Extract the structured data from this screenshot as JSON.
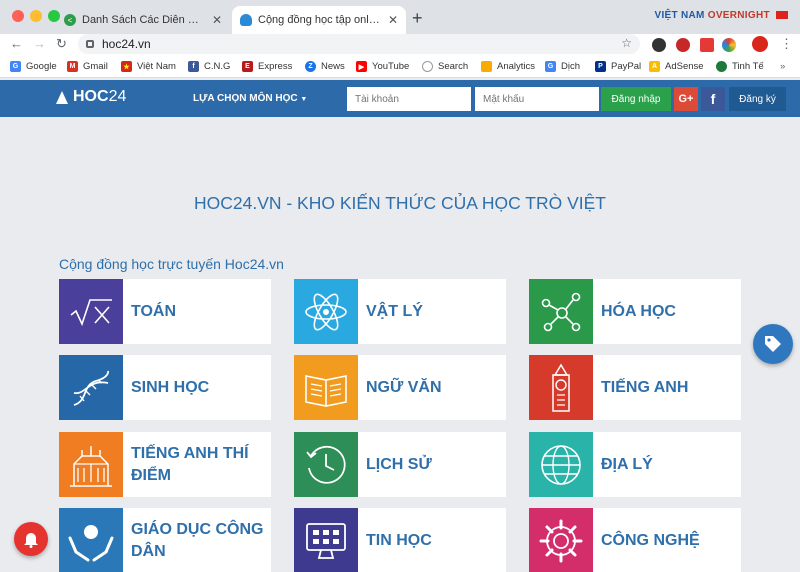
{
  "browser": {
    "tabs": [
      {
        "title": "Danh Sách Các Diễn Đàn Học T"
      },
      {
        "title": "Cộng đồng học tập online | Họ"
      }
    ],
    "brand_left": "VIỆT NAM",
    "brand_right": "OVERNIGHT",
    "url": "hoc24.vn",
    "bookmarks": [
      "Google",
      "Gmail",
      "Việt Nam",
      "C.N.G",
      "Express",
      "News",
      "YouTube",
      "Search",
      "Analytics",
      "Dịch",
      "PayPal",
      "AdSense",
      "Tinh Tế"
    ]
  },
  "header": {
    "logo_bold": "HOC",
    "logo_num": "24",
    "subjects_menu": "LỰA CHỌN MÔN HỌC",
    "username_placeholder": "Tài khoản",
    "password_placeholder": "Mật khẩu",
    "login_label": "Đăng nhập",
    "google_label": "G+",
    "facebook_label": "f",
    "register_label": "Đăng ký"
  },
  "main": {
    "headline": "HOC24.VN - KHO KIẾN THỨC CỦA HỌC TRÒ VIỆT",
    "community_title": "Cộng đồng học trực tuyến Hoc24.vn",
    "subjects": [
      {
        "label": "TOÁN",
        "icon": "math-sqrt-icon",
        "color": "#4a3f9a"
      },
      {
        "label": "VẬT LÝ",
        "icon": "atom-icon",
        "color": "#2aa9e0"
      },
      {
        "label": "HÓA HỌC",
        "icon": "molecule-icon",
        "color": "#2a9a4a"
      },
      {
        "label": "SINH HỌC",
        "icon": "dna-icon",
        "color": "#2667a8"
      },
      {
        "label": "NGỮ VĂN",
        "icon": "book-icon",
        "color": "#f29c1f"
      },
      {
        "label": "TIẾNG ANH",
        "icon": "big-ben-icon",
        "color": "#d63a2a"
      },
      {
        "label": "TIẾNG ANH THÍ ĐIỂM",
        "icon": "building-icon",
        "color": "#f07d22"
      },
      {
        "label": "LỊCH SỬ",
        "icon": "history-clock-icon",
        "color": "#2e8e57"
      },
      {
        "label": "ĐỊA LÝ",
        "icon": "globe-icon",
        "color": "#2ab3a8"
      },
      {
        "label": "GIÁO DỤC CÔNG DÂN",
        "icon": "hands-person-icon",
        "color": "#2b78b8"
      },
      {
        "label": "TIN HỌC",
        "icon": "computer-icon",
        "color": "#3e3a8f"
      },
      {
        "label": "CÔNG NGHỆ",
        "icon": "gear-icon",
        "color": "#d32e6a"
      }
    ]
  }
}
